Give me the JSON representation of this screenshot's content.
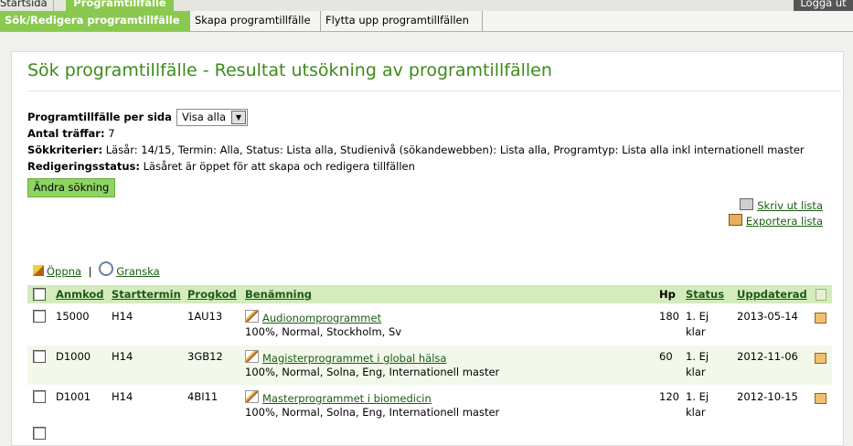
{
  "topnav": {
    "home": "Startsida",
    "programs": "Programtillfälle",
    "logout": "Logga ut"
  },
  "subnav": [
    "Sök/Redigera programtillfälle",
    "Skapa programtillfälle",
    "Flytta upp programtillfällen"
  ],
  "page": {
    "title": "Sök programtillfälle - Resultat utsökning av programtillfällen",
    "per_page_label": "Programtillfälle per sida",
    "per_page_value": "Visa alla",
    "hits_label": "Antal träffar:",
    "hits_value": "7",
    "criteria_label": "Sökkriterier:",
    "criteria_value": "Läsår: 14/15, Termin: Alla, Status: Lista alla, Studienivå (sökandewebben): Lista alla, Programtyp: Lista alla inkl internationell master",
    "edit_status_label": "Redigeringsstatus:",
    "edit_status_value": "Läsåret är öppet för att skapa och redigera tillfällen",
    "change_search": "Ändra sökning",
    "print_list": "Skriv ut lista",
    "export_list": "Exportera lista",
    "open": "Öppna",
    "sep": "|",
    "review": "Granska"
  },
  "table": {
    "headers": {
      "anmkod": "Anmkod",
      "starttermin": "Starttermin",
      "progkod": "Progkod",
      "benamning": "Benämning",
      "hp": "Hp",
      "status": "Status",
      "updated": "Uppdaterad"
    },
    "rows": [
      {
        "anmkod": "15000",
        "starttermin": "H14",
        "progkod": "1AU13",
        "name": "Audionomprogrammet",
        "details": "100%, Normal, Stockholm, Sv",
        "hp": "180",
        "status1": "1. Ej",
        "status2": "klar",
        "updated": "2013-05-14"
      },
      {
        "anmkod": "D1000",
        "starttermin": "H14",
        "progkod": "3GB12",
        "name": "Magisterprogrammet i global hälsa",
        "details": "100%, Normal, Solna, Eng, Internationell master",
        "hp": "60",
        "status1": "1. Ej",
        "status2": "klar",
        "updated": "2012-11-06"
      },
      {
        "anmkod": "D1001",
        "starttermin": "H14",
        "progkod": "4BI11",
        "name": "Masterprogrammet i biomedicin",
        "details": "100%, Normal, Solna, Eng, Internationell master",
        "hp": "120",
        "status1": "1. Ej",
        "status2": "klar",
        "updated": "2012-10-15"
      }
    ]
  },
  "colors": {
    "accent": "#8ac850",
    "title": "#3d8b1a",
    "header_bg": "#d4ebbd",
    "alt_row": "#f2f9ea"
  }
}
